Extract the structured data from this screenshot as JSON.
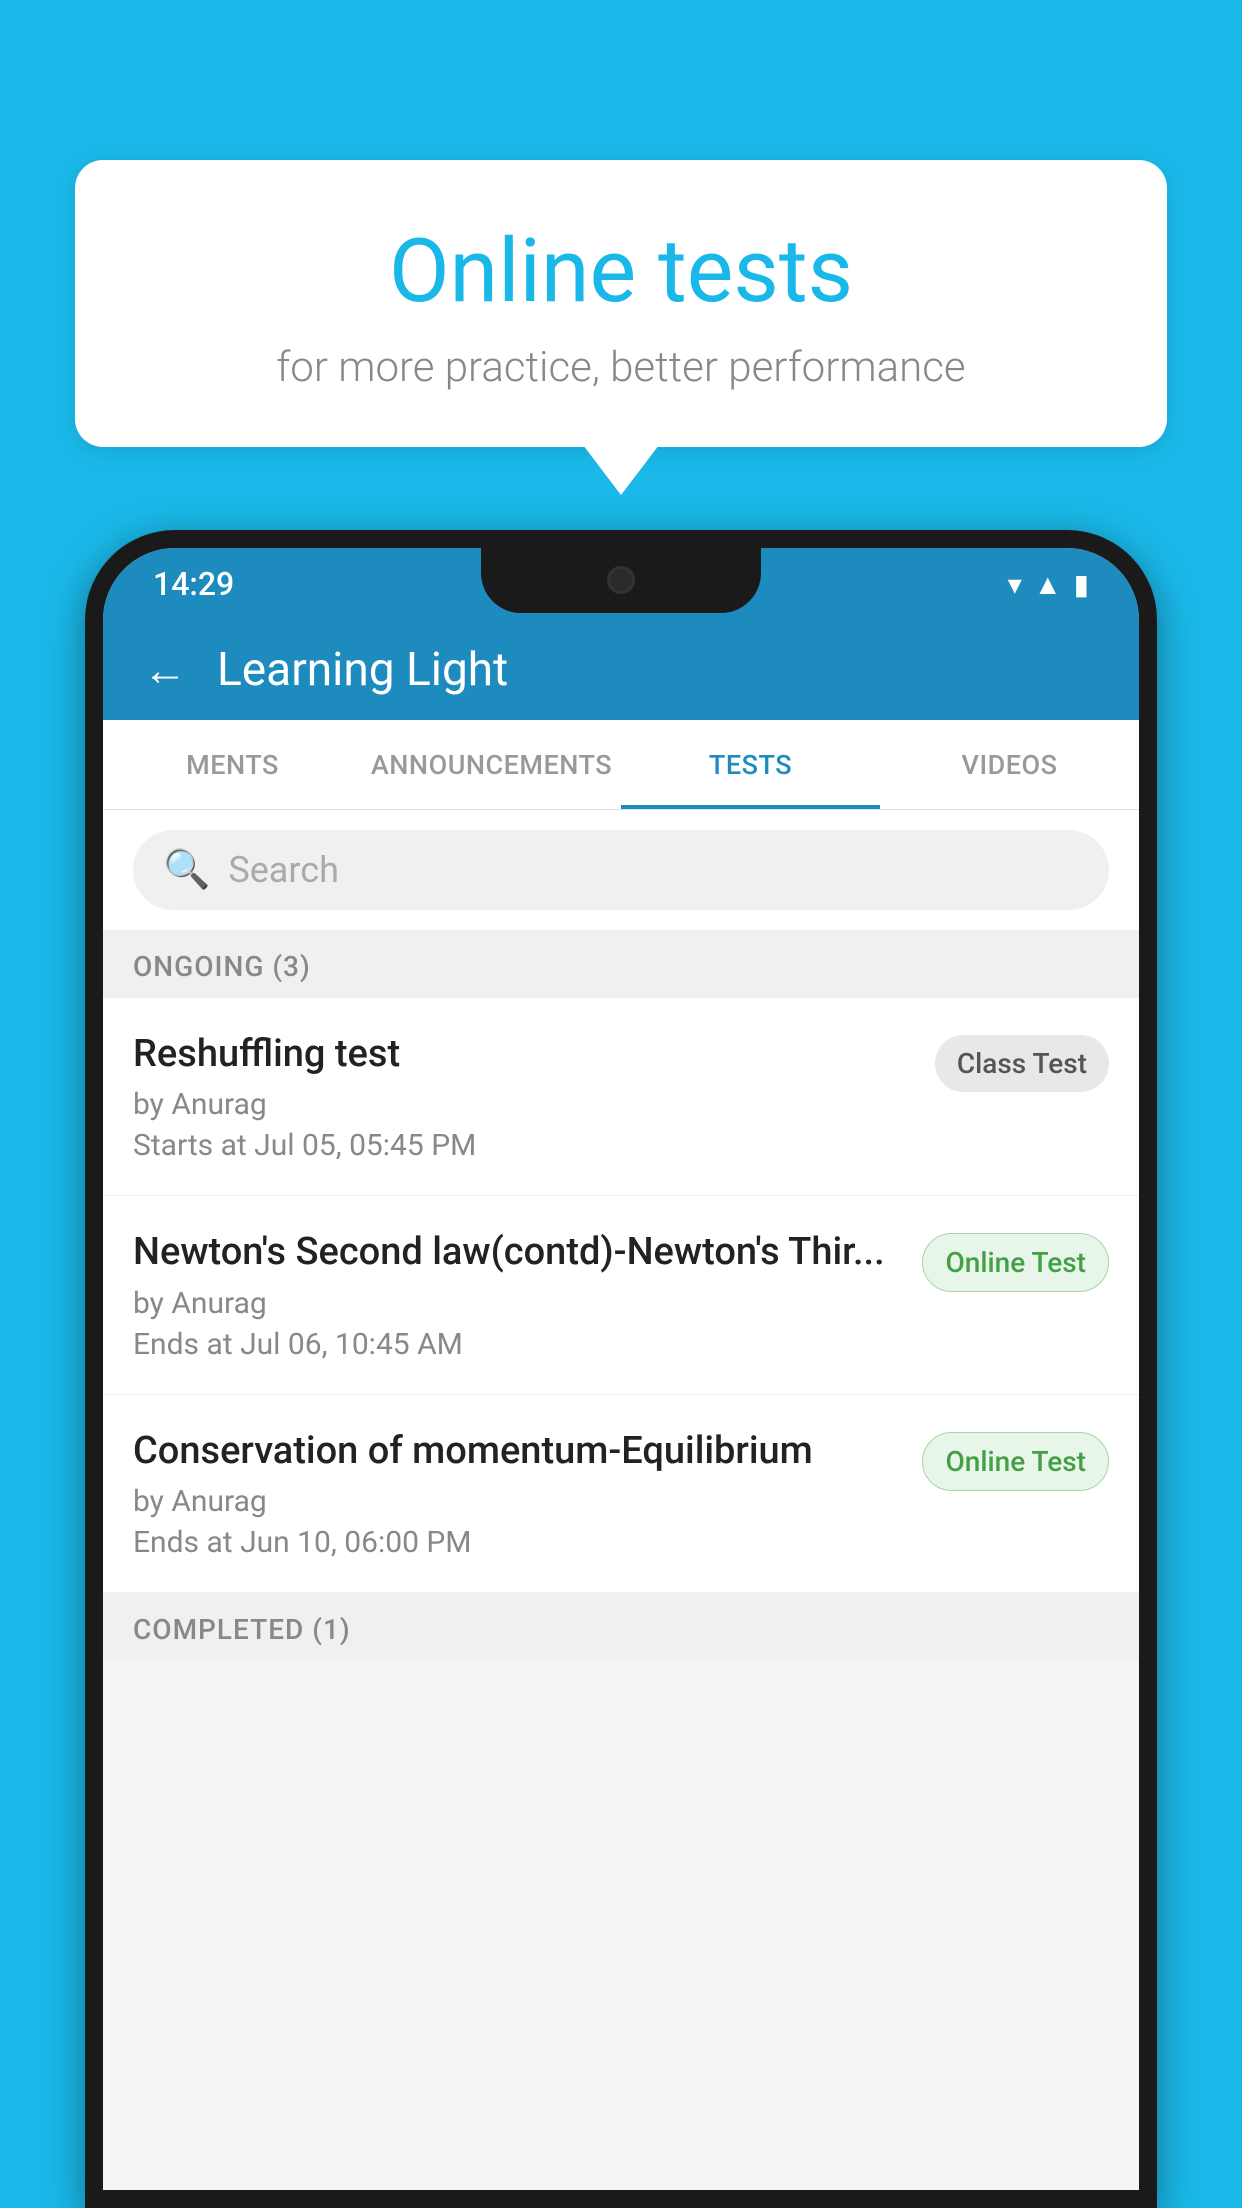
{
  "background_color": "#1ab8e8",
  "speech_bubble": {
    "title": "Online tests",
    "subtitle": "for more practice, better performance"
  },
  "phone": {
    "status_bar": {
      "time": "14:29",
      "icons": [
        "wifi",
        "signal",
        "battery"
      ]
    },
    "header": {
      "title": "Learning Light",
      "back_label": "←"
    },
    "tabs": [
      {
        "label": "MENTS",
        "active": false
      },
      {
        "label": "ANNOUNCEMENTS",
        "active": false
      },
      {
        "label": "TESTS",
        "active": true
      },
      {
        "label": "VIDEOS",
        "active": false
      }
    ],
    "search": {
      "placeholder": "Search"
    },
    "sections": [
      {
        "label": "ONGOING (3)",
        "items": [
          {
            "title": "Reshuffling test",
            "author": "by Anurag",
            "date_label": "Starts at",
            "date": "Jul 05, 05:45 PM",
            "badge": "Class Test",
            "badge_type": "class"
          },
          {
            "title": "Newton's Second law(contd)-Newton's Thir...",
            "author": "by Anurag",
            "date_label": "Ends at",
            "date": "Jul 06, 10:45 AM",
            "badge": "Online Test",
            "badge_type": "online"
          },
          {
            "title": "Conservation of momentum-Equilibrium",
            "author": "by Anurag",
            "date_label": "Ends at",
            "date": "Jun 10, 06:00 PM",
            "badge": "Online Test",
            "badge_type": "online"
          }
        ]
      }
    ],
    "completed_section_label": "COMPLETED (1)"
  }
}
